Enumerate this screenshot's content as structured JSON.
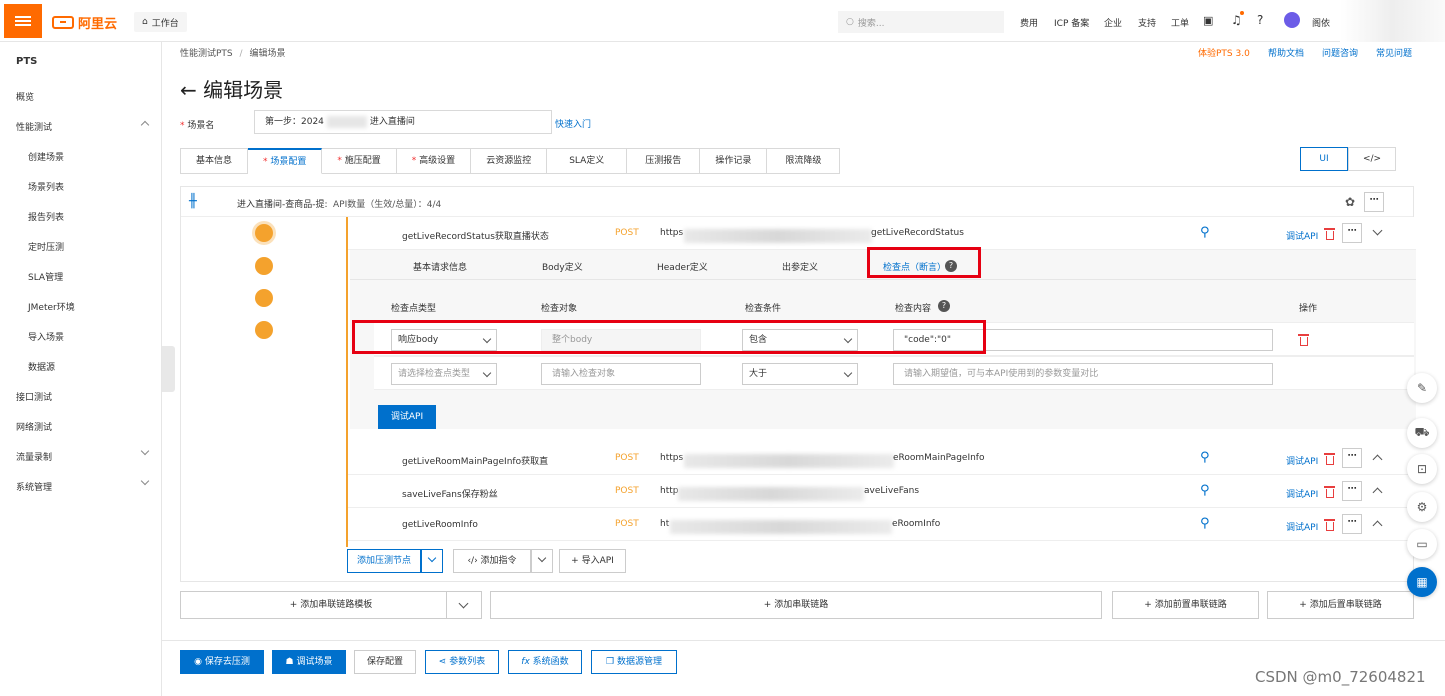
{
  "topbar": {
    "logo": "阿里云",
    "workspace": "工作台",
    "search_placeholder": "搜索...",
    "nav": [
      "费用",
      "ICP 备案",
      "企业",
      "支持",
      "工单"
    ],
    "user": "阁依"
  },
  "sidebar": {
    "title": "PTS",
    "items": [
      {
        "label": "概览"
      },
      {
        "label": "性能测试"
      },
      {
        "label": "创建场景"
      },
      {
        "label": "场景列表"
      },
      {
        "label": "报告列表"
      },
      {
        "label": "定时压测"
      },
      {
        "label": "SLA管理"
      },
      {
        "label": "JMeter环境"
      },
      {
        "label": "导入场景"
      },
      {
        "label": "数据源"
      },
      {
        "label": "接口测试"
      },
      {
        "label": "网络测试"
      },
      {
        "label": "流量录制"
      },
      {
        "label": "系统管理"
      }
    ]
  },
  "header": {
    "breadcrumb_1": "性能测试PTS",
    "breadcrumb_sep": "/",
    "breadcrumb_2": "编辑场景",
    "links": [
      "体验PTS 3.0",
      "帮助文档",
      "问题咨询",
      "常见问题"
    ],
    "title": "编辑场景"
  },
  "scene": {
    "label": "场景名",
    "value": "第一步：2024",
    "value_tail": "进入直播间",
    "quick_start": "快速入门"
  },
  "tabs": [
    {
      "label": "基本信息",
      "required": false
    },
    {
      "label": "场景配置",
      "required": true
    },
    {
      "label": "施压配置",
      "required": true
    },
    {
      "label": "高级设置",
      "required": true
    },
    {
      "label": "云资源监控",
      "required": false
    },
    {
      "label": "SLA定义",
      "required": false
    },
    {
      "label": "压测报告",
      "required": false
    },
    {
      "label": "操作记录",
      "required": false
    },
    {
      "label": "限流降级",
      "required": false
    }
  ],
  "view_toggle": {
    "ui": "UI",
    "code": "</>"
  },
  "chain": {
    "name": "进入直播间-查商品-提:",
    "api_count": "API数量（生效/总量）：4/4"
  },
  "apis": [
    {
      "name": "getLiveRecordStatus获取直播状态",
      "method": "POST",
      "url_prefix": "https",
      "url_suffix": "getLiveRecordStatus",
      "debug": "调试API"
    },
    {
      "name": "getLiveRoomMainPageInfo获取直",
      "method": "POST",
      "url_prefix": "https",
      "url_suffix": "eRoomMainPageInfo",
      "debug": "调试API"
    },
    {
      "name": "saveLiveFans保存粉丝",
      "method": "POST",
      "url_prefix": "http",
      "url_suffix": "aveLiveFans",
      "debug": "调试API"
    },
    {
      "name": "getLiveRoomInfo",
      "method": "POST",
      "url_prefix": "ht",
      "url_suffix": "eRoomInfo",
      "debug": "调试API"
    }
  ],
  "subtabs": [
    "基本请求信息",
    "Body定义",
    "Header定义",
    "出参定义",
    "检查点（断言）"
  ],
  "checkpoint_table": {
    "headers": [
      "检查点类型",
      "检查对象",
      "检查条件",
      "检查内容",
      "操作"
    ],
    "row1": {
      "type": "响应body",
      "object_placeholder": "整个body",
      "condition": "包含",
      "content": "\"code\":\"0\""
    },
    "row2": {
      "type_placeholder": "请选择检查点类型",
      "object_placeholder": "请输入检查对象",
      "condition": "大于",
      "content_placeholder": "请输入期望值，可与本API使用到的参数变量对比"
    },
    "debug_button": "调试API"
  },
  "node_actions": {
    "add_node": "添加压测节点",
    "add_instruction": "添加指令",
    "import_api": "导入API"
  },
  "chain_actions": {
    "add_template": "+ 添加串联链路模板",
    "add_chain": "+ 添加串联链路",
    "add_pre": "+ 添加前置串联链路",
    "add_post": "+ 添加后置串联链路"
  },
  "bottom": {
    "save_run": "保存去压测",
    "debug_scene": "调试场景",
    "save_config": "保存配置",
    "params": "参数列表",
    "functions": "系统函数",
    "datasource": "数据源管理"
  },
  "watermark": "CSDN @m0_72604821",
  "colors": {
    "brand": "#ff6a00",
    "primary": "#0070cc",
    "accent": "#f4a22d",
    "highlight": "#e60012"
  }
}
